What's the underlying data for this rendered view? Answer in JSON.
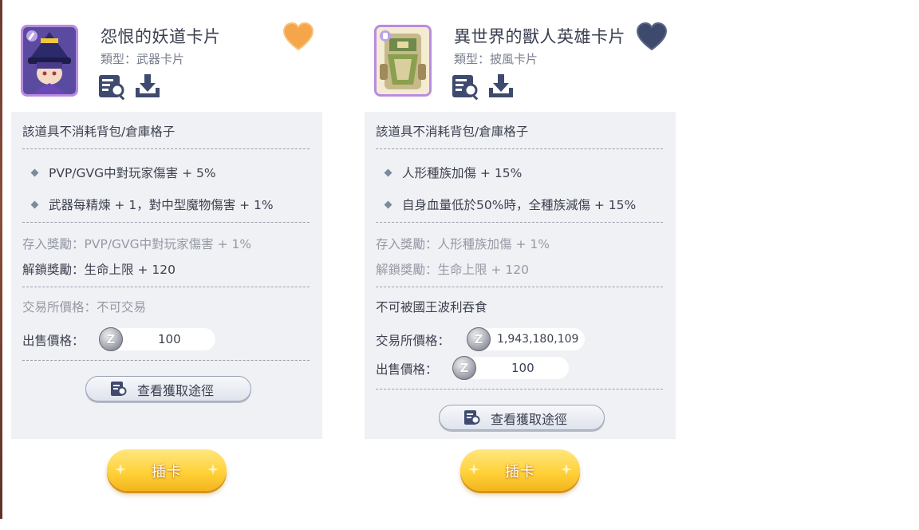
{
  "cards": [
    {
      "title": "怨恨的妖道卡片",
      "type_label": "類型：",
      "type_value": "武器卡片",
      "heart_state": "favorited",
      "heart_color": "#f5a54a",
      "note": "該道具不消耗背包/倉庫格子",
      "effects": [
        "PVP/GVG中對玩家傷害 + 5%",
        "武器每精煉 + 1，對中型魔物傷害 + 1%"
      ],
      "deposit_label": "存入獎勵：",
      "deposit_value": "PVP/GVG中對玩家傷害 + 1%",
      "unlock_label": "解鎖獎勵：",
      "unlock_value": "生命上限 + 120",
      "trade_label": "交易所價格：",
      "trade_value": "不可交易",
      "sell_label": "出售價格：",
      "sell_value": "100",
      "route_button": "查看獲取途徑",
      "insert_button": "插卡"
    },
    {
      "title": "異世界的獸人英雄卡片",
      "type_label": "類型：",
      "type_value": "披風卡片",
      "heart_state": "not-favorited",
      "heart_color": "#3d4a6e",
      "note": "該道具不消耗背包/倉庫格子",
      "effects": [
        "人形種族加傷 + 15%",
        "自身血量低於50%時，全種族減傷 + 15%"
      ],
      "deposit_label": "存入獎勵：",
      "deposit_value": "人形種族加傷 + 1%",
      "unlock_label": "解鎖獎勵：",
      "unlock_value": "生命上限 + 120",
      "restriction": "不可被國王波利吞食",
      "trade_label": "交易所價格：",
      "trade_value": "1,943,180,109",
      "sell_label": "出售價格：",
      "sell_value": "100",
      "route_button": "查看獲取途徑",
      "insert_button": "插卡"
    }
  ],
  "coin_glyph": "Z",
  "icons": [
    "inspect-icon",
    "download-icon",
    "heart-icon",
    "zeny-coin-icon"
  ]
}
